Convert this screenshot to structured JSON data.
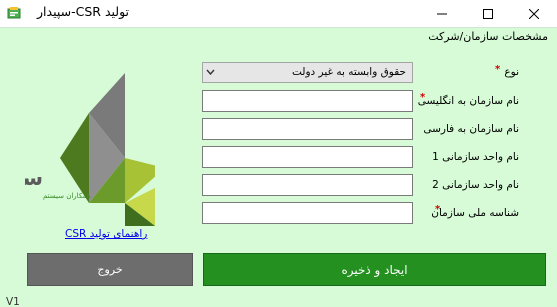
{
  "window": {
    "title": "تولید CSR-سپیدار",
    "controls": {
      "minimize": "minimize-icon",
      "maximize": "maximize-icon",
      "close": "close-icon"
    }
  },
  "group_title": "مشخصات سازمان/شرکت",
  "logo": {
    "brand_text": "سپیدار",
    "tagline": "همکاران سیستم"
  },
  "guide_link": "راهنمای تولید CSR",
  "form": {
    "type": {
      "label": "نوع",
      "required": true,
      "selected": "حقوق وابسته به غیر دولت"
    },
    "org_name_en": {
      "label": "نام سازمان به انگلیسی",
      "required": true,
      "value": ""
    },
    "org_name_fa": {
      "label": "نام سازمان به فارسی",
      "required": false,
      "value": ""
    },
    "unit1": {
      "label": "نام واحد سازمانی 1",
      "required": false,
      "value": ""
    },
    "unit2": {
      "label": "نام واحد سازمانی 2",
      "required": false,
      "value": ""
    },
    "national_id": {
      "label": "شناسه ملی سازمان",
      "required": true,
      "value": ""
    }
  },
  "buttons": {
    "save": "ایجاد و ذخیره",
    "exit": "خروج"
  },
  "version": "V1",
  "colors": {
    "background": "#d6fbd6",
    "save_button": "#23901f",
    "exit_button": "#6d6d6d",
    "required_mark": "#d00000",
    "link": "#0000ee"
  }
}
